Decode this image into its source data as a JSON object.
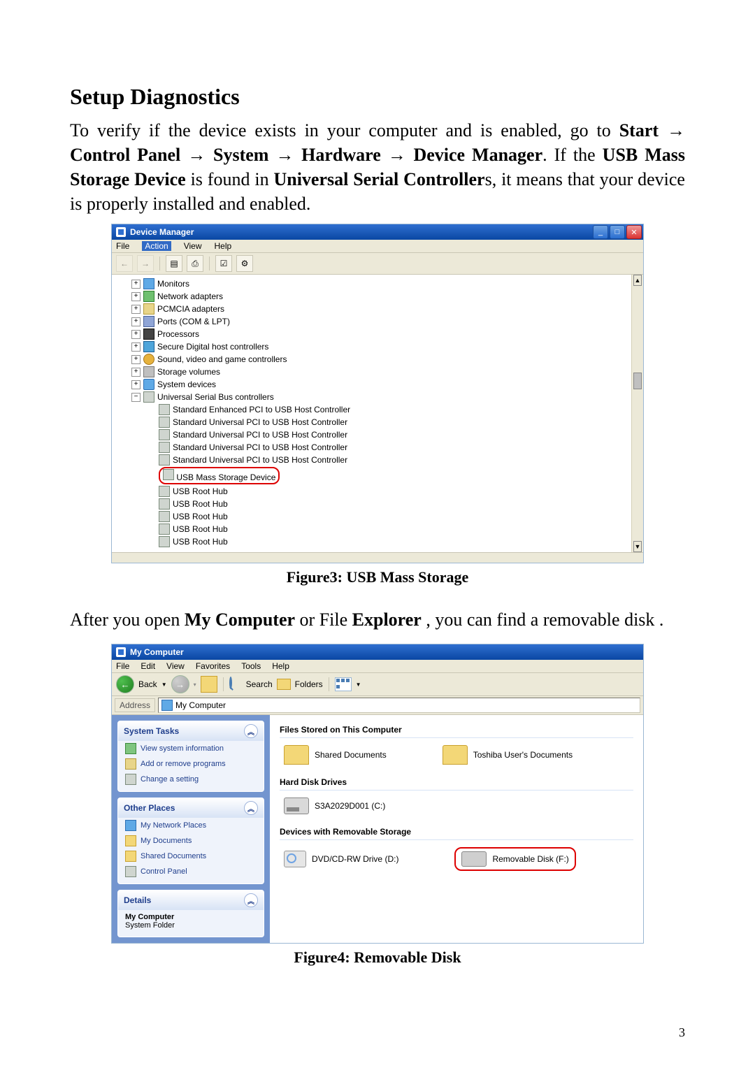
{
  "heading": "Setup Diagnostics",
  "para1_pre": "To verify if the device exists in your computer and is enabled, go to ",
  "path_start": "Start",
  "path_cp": "Control Panel",
  "path_sys": "System",
  "path_hw": "Hardware",
  "path_dm": "Device Manager",
  "para1_post1": ". If the ",
  "usb_mass": "USB Mass Storage Device",
  "para1_post2": " is found in ",
  "usc": "Universal Serial Controller",
  "para1_tail": "s, it means that your device is properly installed and enabled.",
  "arrow": " → ",
  "devmgr": {
    "title": "Device Manager",
    "menu": {
      "file": "File",
      "action": "Action",
      "view": "View",
      "help": "Help"
    },
    "nodes": {
      "monitors": "Monitors",
      "network": "Network adapters",
      "pcmcia": "PCMCIA adapters",
      "ports": "Ports (COM & LPT)",
      "proc": "Processors",
      "sdhost": "Secure Digital host controllers",
      "sound": "Sound, video and game controllers",
      "storage": "Storage volumes",
      "sysdev": "System devices",
      "usbc": "Universal Serial Bus controllers",
      "enh": "Standard Enhanced PCI to USB Host Controller",
      "uni": "Standard Universal PCI to USB Host Controller",
      "mass": "USB Mass Storage Device",
      "hub": "USB Root Hub"
    }
  },
  "fig3": "Figure3: USB Mass Storage",
  "para2_pre": "After you open ",
  "mycomputer": "My Computer",
  "para2_mid": " or File ",
  "explorer": "Explorer",
  "para2_tail": ", you can find a removable disk .",
  "mycomp": {
    "title": "My Computer",
    "menu": {
      "file": "File",
      "edit": "Edit",
      "view": "View",
      "fav": "Favorites",
      "tools": "Tools",
      "help": "Help"
    },
    "toolbar": {
      "back": "Back",
      "search": "Search",
      "folders": "Folders"
    },
    "address_label": "Address",
    "address_value": "My Computer",
    "panels": {
      "tasks": {
        "title": "System Tasks",
        "view_info": "View system information",
        "addremove": "Add or remove programs",
        "change": "Change a setting"
      },
      "other": {
        "title": "Other Places",
        "netplaces": "My Network Places",
        "mydocs": "My Documents",
        "shared": "Shared Documents",
        "cpanel": "Control Panel"
      },
      "details": {
        "title": "Details",
        "line1": "My Computer",
        "line2": "System Folder"
      }
    },
    "sections": {
      "files": "Files Stored on This Computer",
      "hdd": "Hard Disk Drives",
      "remov": "Devices with Removable Storage"
    },
    "items": {
      "shared": "Shared Documents",
      "userdocs": "Toshiba User's Documents",
      "c_drive": "S3A2029D001 (C:)",
      "dvd": "DVD/CD-RW Drive (D:)",
      "removable": "Removable Disk (F:)"
    }
  },
  "fig4": "Figure4: Removable Disk",
  "page": "3"
}
